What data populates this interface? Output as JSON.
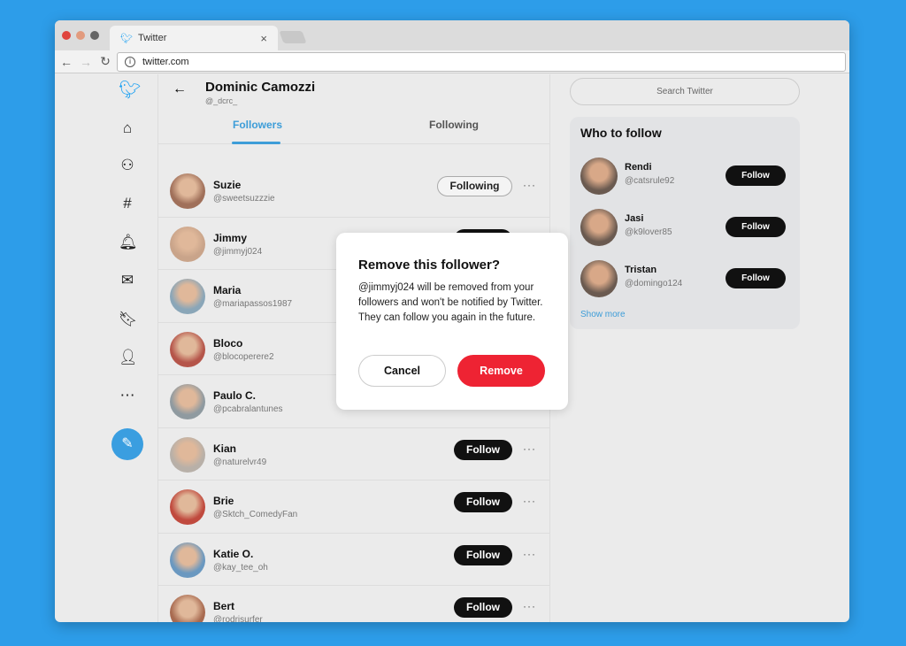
{
  "browser": {
    "tab_title": "Twitter",
    "tab_close": "×",
    "url": "twitter.com",
    "info_icon": "i",
    "back": "←",
    "forward": "→",
    "reload": "↻"
  },
  "colors": {
    "accent": "#3d9dd8",
    "remove": "#ee2333",
    "background": "#2d9de9"
  },
  "sidebar": {
    "icons": [
      "twitter-logo-icon",
      "home-icon",
      "explore-icon",
      "hashtag-icon",
      "bell-icon",
      "mail-icon",
      "bookmark-icon",
      "profile-icon",
      "more-icon",
      "compose-icon"
    ]
  },
  "header": {
    "back": "←",
    "name": "Dominic Camozzi",
    "handle": "@_dcrc_"
  },
  "tabs": [
    {
      "label": "Followers",
      "active": true
    },
    {
      "label": "Following",
      "active": false
    }
  ],
  "followers": [
    {
      "name": "Suzie",
      "handle": "@sweetsuzzzie",
      "button": "Following"
    },
    {
      "name": "Jimmy",
      "handle": "@jimmyj024",
      "button": "Follow"
    },
    {
      "name": "Maria",
      "handle": "@mariapassos1987",
      "button": "Follow"
    },
    {
      "name": "Bloco",
      "handle": "@blocoperere2",
      "button": "Follow"
    },
    {
      "name": "Paulo C.",
      "handle": "@pcabralantunes",
      "button": "Follow"
    },
    {
      "name": "Kian",
      "handle": "@naturelvr49",
      "button": "Follow"
    },
    {
      "name": "Brie",
      "handle": "@Sktch_ComedyFan",
      "button": "Follow"
    },
    {
      "name": "Katie O.",
      "handle": "@kay_tee_oh",
      "button": "Follow"
    },
    {
      "name": "Bert",
      "handle": "@rodrisurfer",
      "button": "Follow"
    }
  ],
  "more_label": "···",
  "search": {
    "placeholder": "Search Twitter"
  },
  "who_to_follow": {
    "title": "Who to follow",
    "items": [
      {
        "name": "Rendi",
        "handle": "@catsrule92",
        "button": "Follow"
      },
      {
        "name": "Jasi",
        "handle": "@k9lover85",
        "button": "Follow"
      },
      {
        "name": "Tristan",
        "handle": "@domingo124",
        "button": "Follow"
      }
    ],
    "show_more": "Show more"
  },
  "modal": {
    "title": "Remove this follower?",
    "body": "@jimmyj024 will be removed from your followers and won't be notified by Twitter. They can follow you again in the future.",
    "cancel": "Cancel",
    "remove": "Remove"
  }
}
